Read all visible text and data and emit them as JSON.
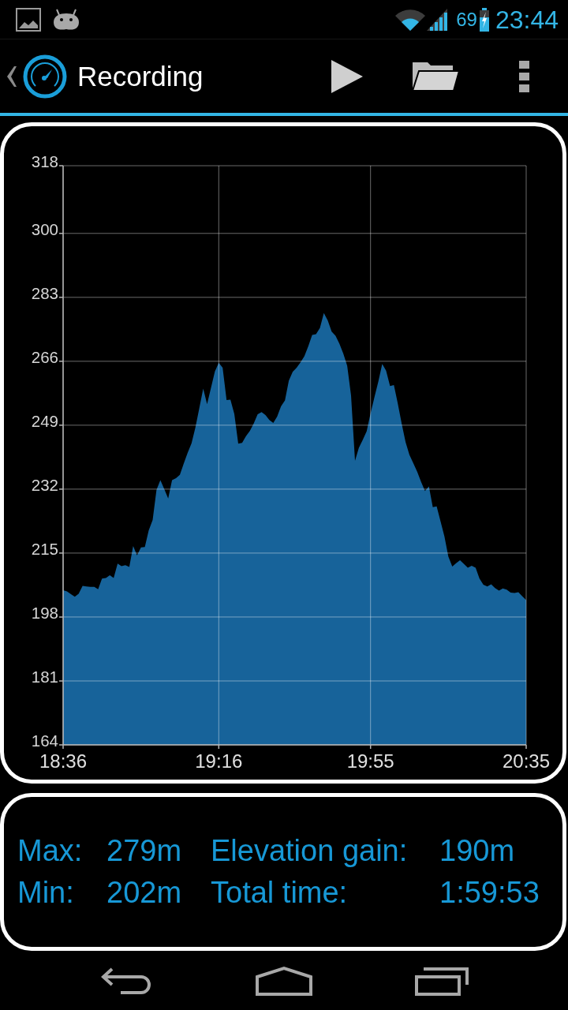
{
  "status_bar": {
    "battery": "69",
    "time": "23:44"
  },
  "action_bar": {
    "title": "Recording"
  },
  "chart": {
    "chart_data": {
      "type": "area",
      "grid": true,
      "ylim": [
        164,
        318
      ],
      "yticks": [
        164,
        181,
        198,
        215,
        232,
        249,
        266,
        283,
        300,
        318
      ],
      "categories": [
        "18:36",
        null,
        null,
        null,
        null,
        null,
        null,
        null,
        null,
        null,
        null,
        null,
        null,
        null,
        null,
        null,
        null,
        null,
        null,
        null,
        null,
        null,
        null,
        null,
        null,
        null,
        null,
        null,
        null,
        null,
        null,
        null,
        null,
        null,
        null,
        null,
        null,
        null,
        null,
        null,
        "19:16",
        null,
        null,
        null,
        null,
        null,
        null,
        null,
        null,
        null,
        null,
        null,
        null,
        null,
        null,
        null,
        null,
        null,
        null,
        null,
        null,
        null,
        null,
        null,
        null,
        null,
        null,
        null,
        null,
        null,
        null,
        null,
        null,
        null,
        null,
        null,
        null,
        null,
        null,
        "19:55",
        null,
        null,
        null,
        null,
        null,
        null,
        null,
        null,
        null,
        null,
        null,
        null,
        null,
        null,
        null,
        null,
        null,
        null,
        null,
        null,
        null,
        null,
        null,
        null,
        null,
        null,
        null,
        null,
        null,
        null,
        null,
        null,
        null,
        null,
        null,
        null,
        null,
        null,
        null,
        "20:35"
      ],
      "series": [
        {
          "color": "#17639a",
          "values": [
            205.1,
            204.8,
            204.1,
            203.4,
            204.2,
            206.3,
            206.1,
            206.0,
            206.0,
            205.4,
            208.2,
            208.4,
            209.1,
            208.4,
            212.2,
            211.5,
            211.8,
            211.3,
            216.9,
            214.4,
            216.5,
            216.6,
            221.0,
            223.8,
            231.8,
            234.4,
            232.0,
            229.5,
            234.4,
            234.9,
            235.8,
            238.8,
            241.6,
            244.2,
            248.4,
            253.5,
            258.7,
            254.6,
            258.9,
            263.3,
            265.6,
            264.3,
            255.7,
            255.8,
            252.0,
            244.1,
            244.3,
            246.1,
            247.5,
            249.5,
            251.9,
            252.5,
            251.7,
            250.4,
            249.6,
            251.3,
            254.0,
            255.6,
            260.8,
            263.2,
            264.3,
            265.7,
            267.3,
            270.0,
            273.0,
            273.2,
            274.9,
            278.8,
            276.9,
            273.9,
            272.8,
            270.7,
            268.0,
            264.8,
            256.9,
            239.5,
            243.0,
            245.1,
            247.4,
            252.1,
            256.4,
            260.6,
            265.3,
            263.5,
            259.4,
            259.7,
            254.8,
            249.4,
            244.5,
            241.1,
            238.9,
            236.6,
            233.9,
            231.5,
            232.7,
            227.2,
            227.4,
            223.4,
            219.4,
            214.1,
            211.4,
            212.3,
            213.1,
            212.1,
            211.1,
            211.6,
            211.1,
            208.2,
            206.6,
            206.1,
            206.7,
            205.7,
            205.0,
            205.6,
            205.3,
            204.5,
            204.4,
            204.6,
            203.5,
            202.5
          ]
        }
      ]
    }
  },
  "stats": {
    "rows": [
      {
        "items": [
          {
            "label": "Max:",
            "value": "279m"
          },
          {
            "label": "Elevation gain:",
            "value": "190m"
          }
        ]
      },
      {
        "items": [
          {
            "label": "Min:",
            "value": "202m"
          },
          {
            "label": "Total time:",
            "value": "1:59:53"
          }
        ]
      }
    ]
  }
}
